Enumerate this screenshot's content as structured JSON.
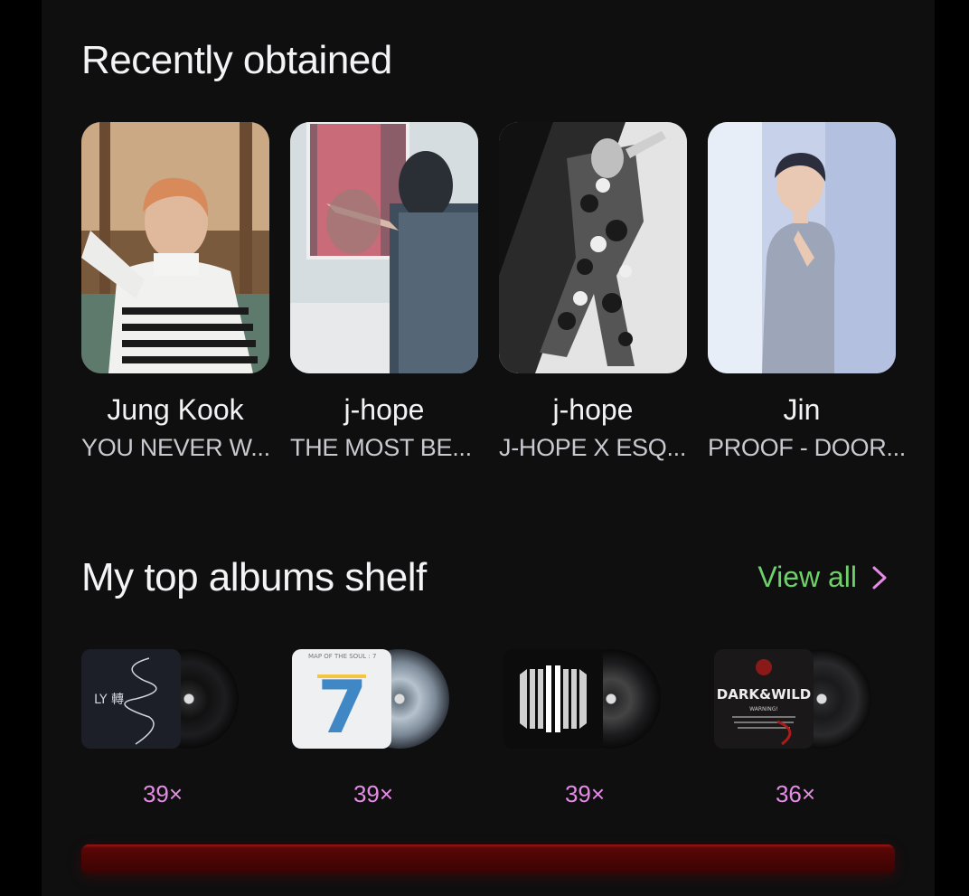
{
  "recent": {
    "title": "Recently obtained",
    "cards": [
      {
        "name": "Jung Kook",
        "album": "YOU NEVER W..."
      },
      {
        "name": "j-hope",
        "album": "THE MOST BE..."
      },
      {
        "name": "j-hope",
        "album": "J-HOPE X ESQ..."
      },
      {
        "name": "Jin",
        "album": "PROOF - DOOR..."
      }
    ]
  },
  "shelf": {
    "title": "My top albums shelf",
    "view_all": "View all",
    "albums": [
      {
        "count": "39×",
        "cover_text": "LY 轉",
        "icon": "love-yourself-cover"
      },
      {
        "count": "39×",
        "cover_text": "7",
        "cover_subtext": "MAP OF THE SOUL : 7",
        "icon": "map-of-the-soul-cover"
      },
      {
        "count": "39×",
        "icon": "proof-cover"
      },
      {
        "count": "36×",
        "cover_text": "DARK&WILD",
        "cover_subtext": "WARNING!",
        "icon": "dark-and-wild-cover"
      }
    ]
  },
  "colors": {
    "background": "#0f0f10",
    "accent_green": "#6fd16a",
    "accent_pink": "#e58be6",
    "bar_red": "#5a0606"
  }
}
